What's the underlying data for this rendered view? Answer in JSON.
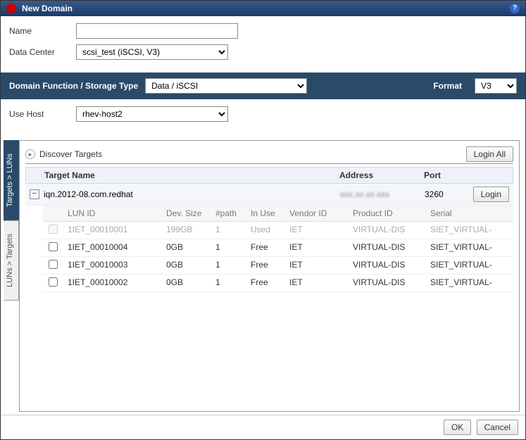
{
  "titlebar": {
    "title": "New Domain"
  },
  "form": {
    "name_label": "Name",
    "name_value": "",
    "datacenter_label": "Data Center",
    "datacenter_value": "scsi_test (iSCSI, V3)",
    "usehost_label": "Use Host",
    "usehost_value": "rhev-host2"
  },
  "typebar": {
    "function_label": "Domain Function / Storage Type",
    "function_value": "Data / iSCSI",
    "format_label": "Format",
    "format_value": "V3"
  },
  "sidetabs": {
    "targets_luns": "Targets > LUNs",
    "luns_targets": "LUNs > Targets"
  },
  "discover": {
    "label": "Discover Targets",
    "login_all": "Login All"
  },
  "target_header": {
    "name": "Target Name",
    "address": "Address",
    "port": "Port"
  },
  "target": {
    "name": "iqn.2012-08.com.redhat",
    "address": "xxx.xx.xx.xxx",
    "port": "3260",
    "login_btn": "Login"
  },
  "lun_header": {
    "id": "LUN ID",
    "size": "Dev. Size",
    "path": "#path",
    "inuse": "In Use",
    "vendor": "Vendor ID",
    "product": "Product ID",
    "serial": "Serial"
  },
  "luns": [
    {
      "id": "1IET_00010001",
      "size": "199GB",
      "path": "1",
      "inuse": "Used",
      "vendor": "IET",
      "product": "VIRTUAL-DIS",
      "serial": "SIET_VIRTUAL-",
      "used": true
    },
    {
      "id": "1IET_00010004",
      "size": "0GB",
      "path": "1",
      "inuse": "Free",
      "vendor": "IET",
      "product": "VIRTUAL-DIS",
      "serial": "SIET_VIRTUAL-",
      "used": false
    },
    {
      "id": "1IET_00010003",
      "size": "0GB",
      "path": "1",
      "inuse": "Free",
      "vendor": "IET",
      "product": "VIRTUAL-DIS",
      "serial": "SIET_VIRTUAL-",
      "used": false
    },
    {
      "id": "1IET_00010002",
      "size": "0GB",
      "path": "1",
      "inuse": "Free",
      "vendor": "IET",
      "product": "VIRTUAL-DIS",
      "serial": "SIET_VIRTUAL-",
      "used": false
    }
  ],
  "footer": {
    "ok": "OK",
    "cancel": "Cancel"
  }
}
